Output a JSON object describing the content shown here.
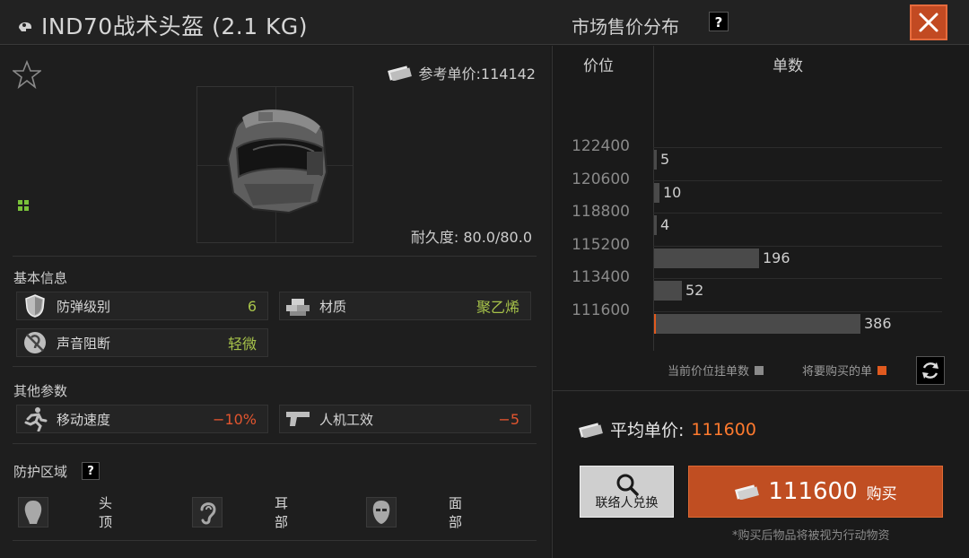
{
  "header": {
    "item_title": "IND70战术头盔 (2.1 KG)",
    "market_title": "市场售价分布",
    "help_symbol": "?"
  },
  "item": {
    "ref_price_label": "参考单价:114142",
    "durability_label": "耐久度: 80.0/80.0",
    "favorited": false
  },
  "sections": {
    "basic": "基本信息",
    "other": "其他参数",
    "protection": "防护区域",
    "help_symbol": "?"
  },
  "basic_stats": [
    {
      "label": "防弹级别",
      "value": "6",
      "icon": "shield-icon"
    },
    {
      "label": "材质",
      "value": "聚乙烯",
      "icon": "material-icon"
    },
    {
      "label": "声音阻断",
      "value": "轻微",
      "icon": "ear-muffle-icon"
    }
  ],
  "other_stats": [
    {
      "label": "移动速度",
      "value": "−10%",
      "icon": "running-icon"
    },
    {
      "label": "人机工效",
      "value": "−5",
      "icon": "pistol-icon"
    }
  ],
  "zones": [
    {
      "label": "头顶",
      "icon": "head-top-icon"
    },
    {
      "label": "耳部",
      "icon": "ear-icon"
    },
    {
      "label": "面部",
      "icon": "face-icon"
    }
  ],
  "market": {
    "col_price": "价位",
    "col_count": "单数",
    "legend_current": "当前价位挂单数",
    "legend_buy": "将要购买的单",
    "avg_label": "平均单价:",
    "avg_value": "111600",
    "contact_label": "联络人兑换",
    "buy_amount": "111600",
    "buy_label": "购买",
    "note": "*购买后物品将被视为行动物资",
    "colors": {
      "bar": "#4a4a4a",
      "buy_marker": "#e05a1f",
      "accent": "#ff7a2e"
    }
  },
  "chart_data": {
    "type": "bar",
    "orientation": "horizontal",
    "categories": [
      "122400",
      "120600",
      "118800",
      "115200",
      "113400",
      "111600"
    ],
    "values": [
      5,
      10,
      4,
      196,
      52,
      386
    ],
    "value_labels": [
      "5",
      "10",
      "4",
      "196",
      "52",
      "386"
    ],
    "xlabel": "单数",
    "ylabel": "价位",
    "highlight_category": "111600"
  }
}
